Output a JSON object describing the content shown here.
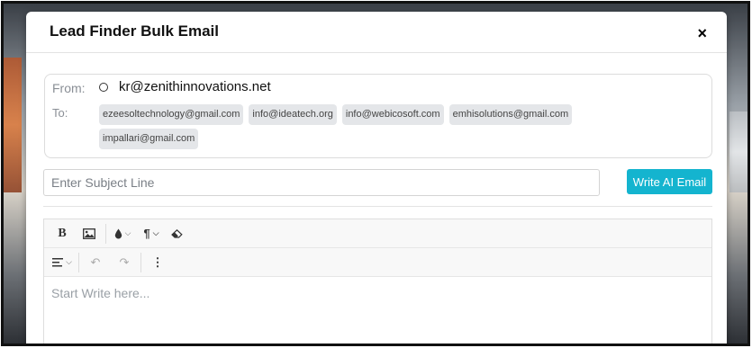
{
  "modal": {
    "title": "Lead Finder Bulk Email",
    "close_icon": "×"
  },
  "from": {
    "label": "From:",
    "address": "kr@zenithinnovations.net"
  },
  "to": {
    "label": "To:",
    "recipients": [
      "ezeesoltechnology@gmail.com",
      "info@ideatech.org",
      "info@webicosoft.com",
      "emhisolutions@gmail.com",
      "impallari@gmail.com"
    ]
  },
  "subject": {
    "placeholder": "Enter Subject Line",
    "value": ""
  },
  "ai_button": {
    "label": "Write AI Email"
  },
  "editor": {
    "placeholder": "Start Write here...",
    "toolbar": {
      "bold": "B",
      "image_icon": "image-icon",
      "color_icon": "ink-drop-icon",
      "paragraph": "¶",
      "eraser_icon": "eraser-icon",
      "align_icon": "align-left-icon",
      "undo": "↶",
      "redo": "↷",
      "more": "⋮"
    }
  },
  "colors": {
    "accent": "#14b4cf",
    "chip_bg": "#e4e6e9"
  }
}
